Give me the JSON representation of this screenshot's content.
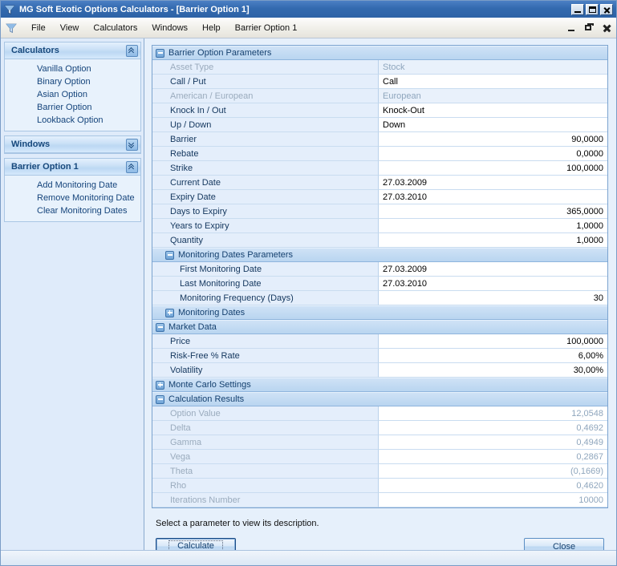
{
  "window": {
    "title": "MG Soft Exotic Options Calculators - [Barrier Option 1]",
    "app_icon": "funnel-icon",
    "buttons": {
      "minimize": "minimize-icon",
      "maximize": "maximize-icon",
      "close": "close-icon"
    }
  },
  "menubar": {
    "icon": "funnel-icon",
    "items": [
      "File",
      "View",
      "Calculators",
      "Windows",
      "Help",
      "Barrier Option 1"
    ],
    "mdi_buttons": {
      "minimize": "mdi-minimize-icon",
      "restore": "mdi-restore-icon",
      "close": "mdi-close-icon"
    }
  },
  "sidebar": {
    "panels": [
      {
        "title": "Calculators",
        "state": "expanded",
        "toggle_icon": "chevron-up-icon",
        "links": [
          "Vanilla Option",
          "Binary Option",
          "Asian Option",
          "Barrier Option",
          "Lookback Option"
        ]
      },
      {
        "title": "Windows",
        "state": "collapsed",
        "toggle_icon": "chevron-down-icon",
        "links": []
      },
      {
        "title": "Barrier Option 1",
        "state": "expanded",
        "toggle_icon": "chevron-up-icon",
        "links": [
          "Add Monitoring Date",
          "Remove Monitoring Date",
          "Clear Monitoring Dates"
        ]
      }
    ]
  },
  "grid": {
    "rows": [
      {
        "kind": "section",
        "level": 0,
        "expanded": true,
        "icon": "minus-box-icon",
        "label": "Barrier Option Parameters"
      },
      {
        "kind": "field",
        "indent": 0,
        "label": "Asset Type",
        "value": "Stock",
        "align": "left",
        "disabled": true
      },
      {
        "kind": "field",
        "indent": 0,
        "label": "Call / Put",
        "value": "Call",
        "align": "left",
        "disabled": false
      },
      {
        "kind": "field",
        "indent": 0,
        "label": "American / European",
        "value": "European",
        "align": "left",
        "disabled": true
      },
      {
        "kind": "field",
        "indent": 0,
        "label": "Knock In / Out",
        "value": "Knock-Out",
        "align": "left",
        "disabled": false
      },
      {
        "kind": "field",
        "indent": 0,
        "label": "Up / Down",
        "value": "Down",
        "align": "left",
        "disabled": false
      },
      {
        "kind": "field",
        "indent": 0,
        "label": "Barrier",
        "value": "90,0000",
        "align": "right",
        "disabled": false
      },
      {
        "kind": "field",
        "indent": 0,
        "label": "Rebate",
        "value": "0,0000",
        "align": "right",
        "disabled": false
      },
      {
        "kind": "field",
        "indent": 0,
        "label": "Strike",
        "value": "100,0000",
        "align": "right",
        "disabled": false
      },
      {
        "kind": "field",
        "indent": 0,
        "label": "Current Date",
        "value": "27.03.2009",
        "align": "left",
        "disabled": false
      },
      {
        "kind": "field",
        "indent": 0,
        "label": "Expiry Date",
        "value": "27.03.2010",
        "align": "left",
        "disabled": false
      },
      {
        "kind": "field",
        "indent": 0,
        "label": "Days to Expiry",
        "value": "365,0000",
        "align": "right",
        "disabled": false
      },
      {
        "kind": "field",
        "indent": 0,
        "label": "Years to Expiry",
        "value": "1,0000",
        "align": "right",
        "disabled": false
      },
      {
        "kind": "field",
        "indent": 0,
        "label": "Quantity",
        "value": "1,0000",
        "align": "right",
        "disabled": false
      },
      {
        "kind": "section",
        "level": 1,
        "expanded": true,
        "icon": "minus-box-icon",
        "label": "Monitoring Dates Parameters"
      },
      {
        "kind": "field",
        "indent": 1,
        "label": "First Monitoring Date",
        "value": "27.03.2009",
        "align": "left",
        "disabled": false
      },
      {
        "kind": "field",
        "indent": 1,
        "label": "Last Monitoring Date",
        "value": "27.03.2010",
        "align": "left",
        "disabled": false
      },
      {
        "kind": "field",
        "indent": 1,
        "label": "Monitoring Frequency (Days)",
        "value": "30",
        "align": "right",
        "disabled": false
      },
      {
        "kind": "section",
        "level": 1,
        "expanded": false,
        "icon": "plus-box-icon",
        "label": "Monitoring Dates"
      },
      {
        "kind": "section",
        "level": 0,
        "expanded": true,
        "icon": "minus-box-icon",
        "label": "Market Data"
      },
      {
        "kind": "field",
        "indent": 0,
        "label": "Price",
        "value": "100,0000",
        "align": "right",
        "disabled": false
      },
      {
        "kind": "field",
        "indent": 0,
        "label": "Risk-Free % Rate",
        "value": "6,00%",
        "align": "right",
        "disabled": false
      },
      {
        "kind": "field",
        "indent": 0,
        "label": "Volatility",
        "value": "30,00%",
        "align": "right",
        "disabled": false
      },
      {
        "kind": "section",
        "level": 0,
        "expanded": false,
        "icon": "plus-box-icon",
        "label": "Monte Carlo Settings"
      },
      {
        "kind": "section",
        "level": 0,
        "expanded": true,
        "icon": "minus-box-icon",
        "label": "Calculation Results"
      },
      {
        "kind": "field",
        "indent": 0,
        "label": "Option Value",
        "value": "12,0548",
        "align": "right",
        "disabled": true
      },
      {
        "kind": "field",
        "indent": 0,
        "label": "Delta",
        "value": "0,4692",
        "align": "right",
        "disabled": true
      },
      {
        "kind": "field",
        "indent": 0,
        "label": "Gamma",
        "value": "0,4949",
        "align": "right",
        "disabled": true
      },
      {
        "kind": "field",
        "indent": 0,
        "label": "Vega",
        "value": "0,2867",
        "align": "right",
        "disabled": true
      },
      {
        "kind": "field",
        "indent": 0,
        "label": "Theta",
        "value": "(0,1669)",
        "align": "right",
        "disabled": true
      },
      {
        "kind": "field",
        "indent": 0,
        "label": "Rho",
        "value": "0,4620",
        "align": "right",
        "disabled": true
      },
      {
        "kind": "field",
        "indent": 0,
        "label": "Iterations Number",
        "value": "10000",
        "align": "right",
        "disabled": true
      }
    ]
  },
  "footer": {
    "description": "Select a parameter to view its description.",
    "calculate_label": "Calculate",
    "close_label": "Close"
  },
  "colors": {
    "titlebar": "#336aaf",
    "accent_text": "#14406f",
    "label_bg": "#e4eefb",
    "section_bg": "#bfd8f1",
    "disabled_text": "#8fa6bd",
    "content_bg": "#e6f0fb"
  }
}
